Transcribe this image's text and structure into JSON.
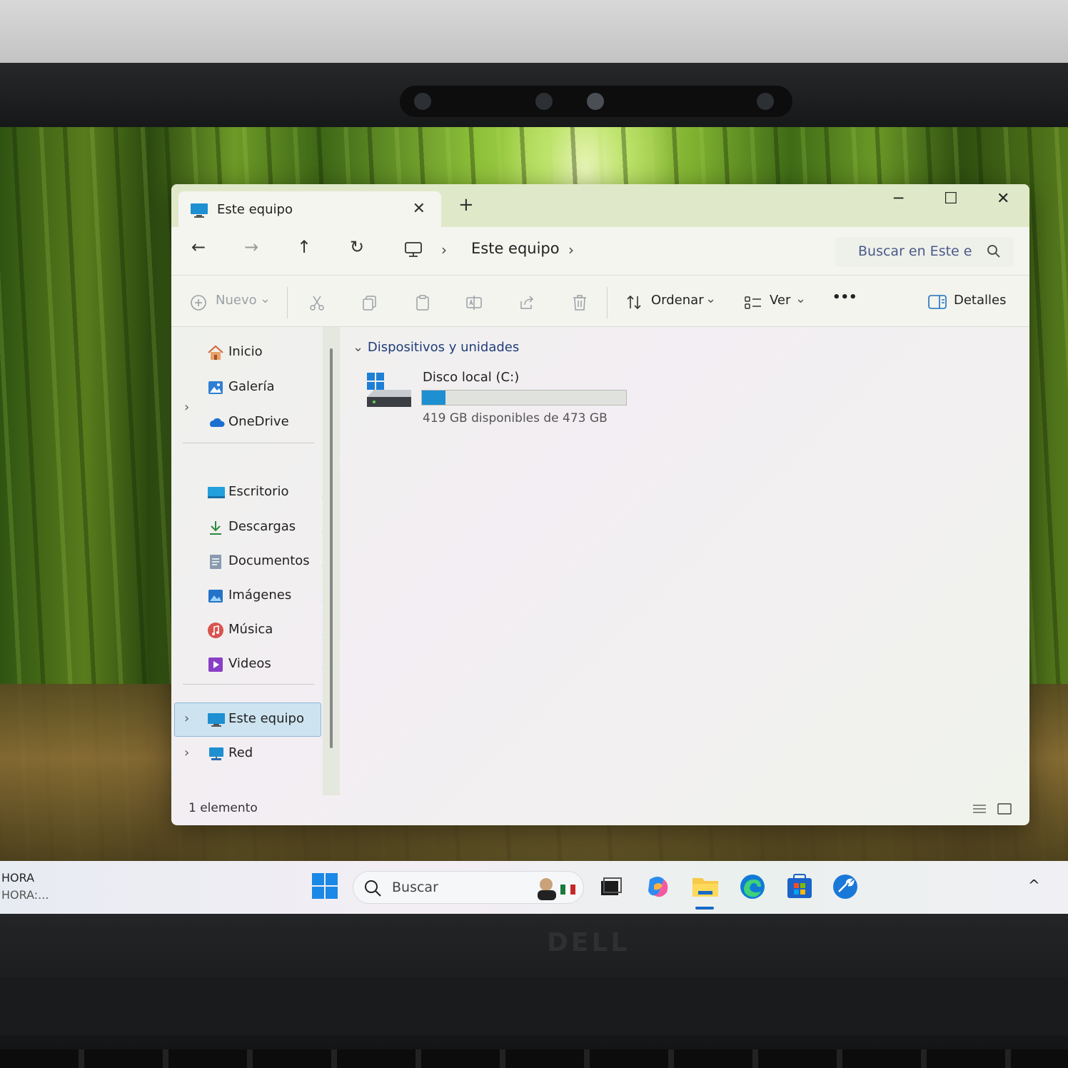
{
  "window": {
    "tab_title": "Este equipo",
    "tab_close": "✕",
    "new_tab": "+",
    "minimize": "─",
    "maximize": "☐",
    "close": "✕"
  },
  "address": {
    "back": "←",
    "forward": "→",
    "up": "↑",
    "refresh": "↻",
    "separator": "›",
    "location": "Este equipo",
    "search_placeholder": "Buscar en Este e"
  },
  "toolbar": {
    "new_label": "Nuevo",
    "sort_label": "Ordenar",
    "view_label": "Ver",
    "more_label": "•••",
    "details_label": "Detalles",
    "dropdown": "⌄"
  },
  "sidebar": {
    "top": [
      {
        "label": "Inicio",
        "icon": "home-icon"
      },
      {
        "label": "Galería",
        "icon": "gallery-icon"
      },
      {
        "label": "OneDrive",
        "icon": "cloud-icon"
      }
    ],
    "pinned": [
      {
        "label": "Escritorio",
        "icon": "desktop-icon"
      },
      {
        "label": "Descargas",
        "icon": "download-icon"
      },
      {
        "label": "Documentos",
        "icon": "documents-icon"
      },
      {
        "label": "Imágenes",
        "icon": "pictures-icon"
      },
      {
        "label": "Música",
        "icon": "music-icon"
      },
      {
        "label": "Videos",
        "icon": "videos-icon"
      }
    ],
    "pin_glyph": "📌",
    "chevron": "›",
    "bottom": [
      {
        "label": "Este equipo",
        "icon": "this-pc-icon",
        "selected": true
      },
      {
        "label": "Red",
        "icon": "network-icon",
        "selected": false
      }
    ]
  },
  "content": {
    "group_chevron": "⌄",
    "group_title": "Dispositivos y unidades",
    "drive": {
      "name": "Disco local (C:)",
      "free_text": "419 GB disponibles de 473 GB",
      "used_fraction": 0.114
    }
  },
  "status": {
    "item_count": "1 elemento"
  },
  "taskbar": {
    "left_line1": "HORA",
    "left_line2": "HORA:...",
    "search_placeholder": "Buscar",
    "tray_chevron": "^"
  },
  "bezel": {
    "brand": "DELL"
  },
  "colors": {
    "accent": "#1e8fd1",
    "selection": "#cde4f0",
    "taskbar_active": "#1669c8"
  }
}
